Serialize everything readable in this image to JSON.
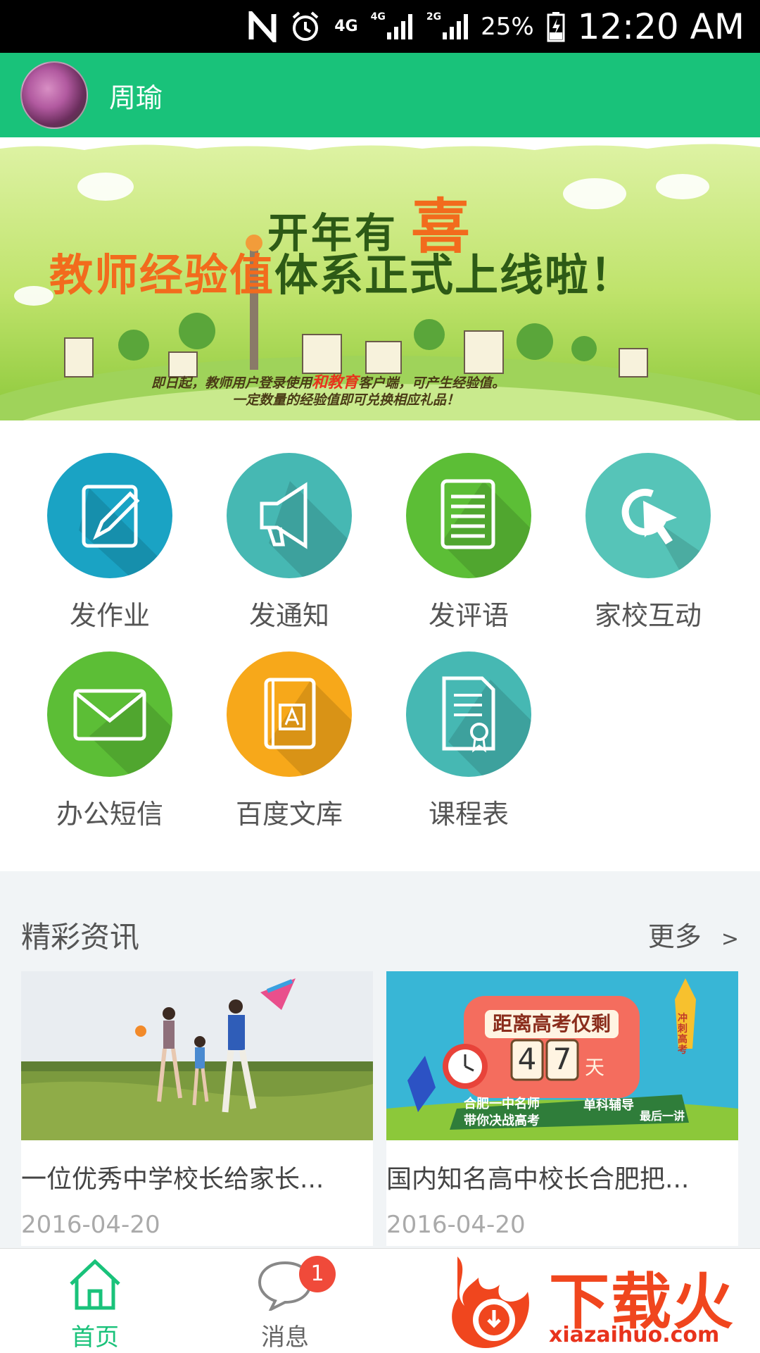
{
  "status_bar": {
    "network_4g": "4G",
    "network_4g_small": "4G",
    "network_2g": "2G",
    "battery": "25%",
    "time": "12:20 AM"
  },
  "header": {
    "username": "周瑜"
  },
  "banner": {
    "line1": "开年有",
    "line1_highlight": "喜",
    "line2_highlight": "教师经验值",
    "line2": "体系正式上线",
    "line2_end": "啦！",
    "sub1_a": "即日起，教师用户登录使用",
    "sub1_red": "和教育",
    "sub1_b": "客户端，可产生经验值。",
    "sub2": "一定数量的经验值即可兑换相应礼品！"
  },
  "features": [
    {
      "label": "发作业",
      "icon": "edit-icon",
      "color": "#1aa3c4"
    },
    {
      "label": "发通知",
      "icon": "megaphone-icon",
      "color": "#46b8b3"
    },
    {
      "label": "发评语",
      "icon": "document-icon",
      "color": "#5cbe36"
    },
    {
      "label": "家校互动",
      "icon": "cursor-click-icon",
      "color": "#56c4b8"
    },
    {
      "label": "办公短信",
      "icon": "mail-icon",
      "color": "#5cbe36"
    },
    {
      "label": "百度文库",
      "icon": "book-icon",
      "color": "#f7a81a"
    },
    {
      "label": "课程表",
      "icon": "certificate-icon",
      "color": "#46b8b3"
    }
  ],
  "news": {
    "title": "精彩资讯",
    "more": "更多",
    "more_arrow": ">",
    "items": [
      {
        "title": "一位优秀中学校长给家长...",
        "date": "2016-04-20"
      },
      {
        "title": "国内知名高中校长合肥把...",
        "date": "2016-04-20",
        "img_heading": "距离高考仅剩",
        "img_digit1": "4",
        "img_digit2": "7",
        "img_unit": "天",
        "img_tag1": "合肥一中名师",
        "img_tag2": "带你决战高考",
        "img_tag3": "单科辅导",
        "img_tag4": "最后一讲",
        "img_rocket": "冲刺高考"
      }
    ]
  },
  "tabs": [
    {
      "label": "首页",
      "icon": "home-icon",
      "active": true
    },
    {
      "label": "消息",
      "icon": "chat-bubble-icon",
      "badge": "1"
    }
  ],
  "watermark": {
    "text": "下载火",
    "url": "xiazaihuo.com"
  },
  "colors": {
    "primary": "#19c27a",
    "badge": "#f04a3a"
  }
}
